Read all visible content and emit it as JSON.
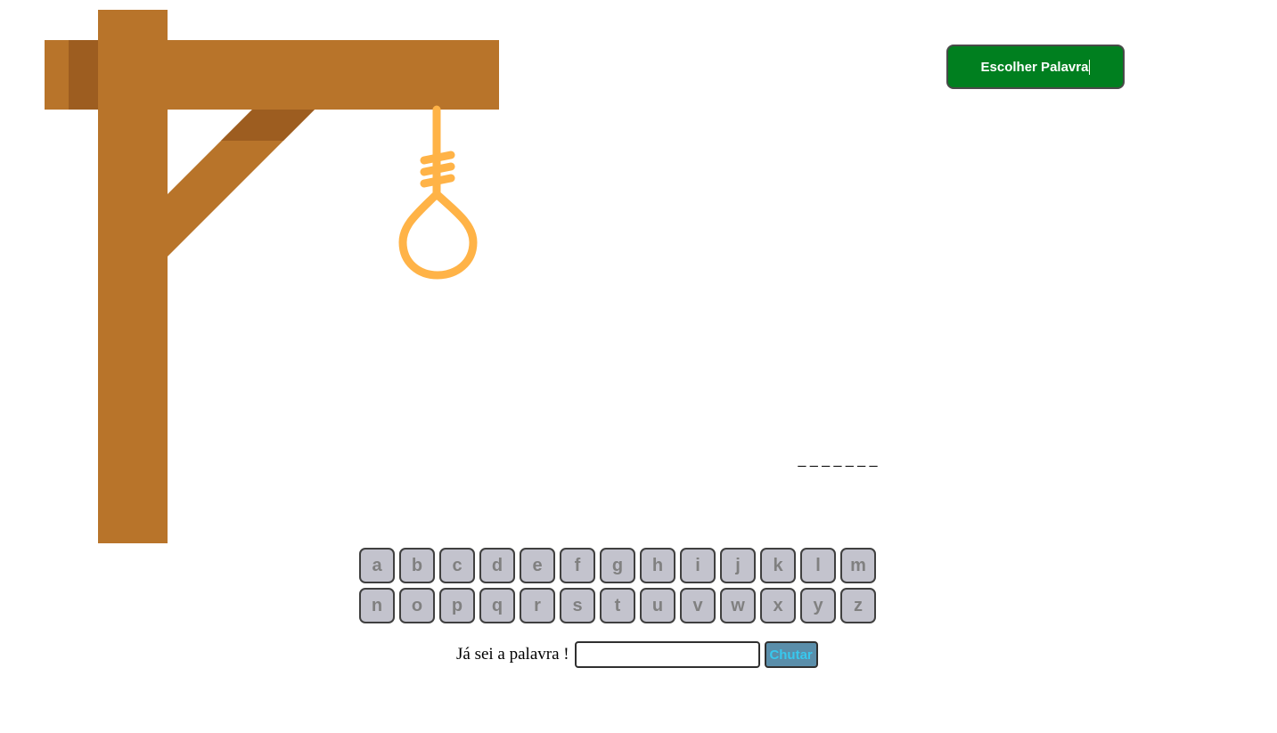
{
  "header": {
    "choose_word_label": "Escolher Palavra"
  },
  "game": {
    "word_blanks": "_ _ _ _ _ _ _",
    "wrong_guesses": 0
  },
  "keyboard": {
    "row1": [
      "a",
      "b",
      "c",
      "d",
      "e",
      "f",
      "g",
      "h",
      "i",
      "j",
      "k",
      "l",
      "m"
    ],
    "row2": [
      "n",
      "o",
      "p",
      "q",
      "r",
      "s",
      "t",
      "u",
      "v",
      "w",
      "x",
      "y",
      "z"
    ]
  },
  "guess": {
    "label": "Já sei a palavra !",
    "input_value": "",
    "button_label": "Chutar"
  },
  "colors": {
    "wood": "#b8742a",
    "wood_shadow": "#9d5d20",
    "rope": "#ffb347",
    "choose_button": "#007f1f",
    "key_bg": "#c3c3cd",
    "guess_button_bg": "#5a8eaa",
    "guess_button_text": "#37c8ee"
  }
}
